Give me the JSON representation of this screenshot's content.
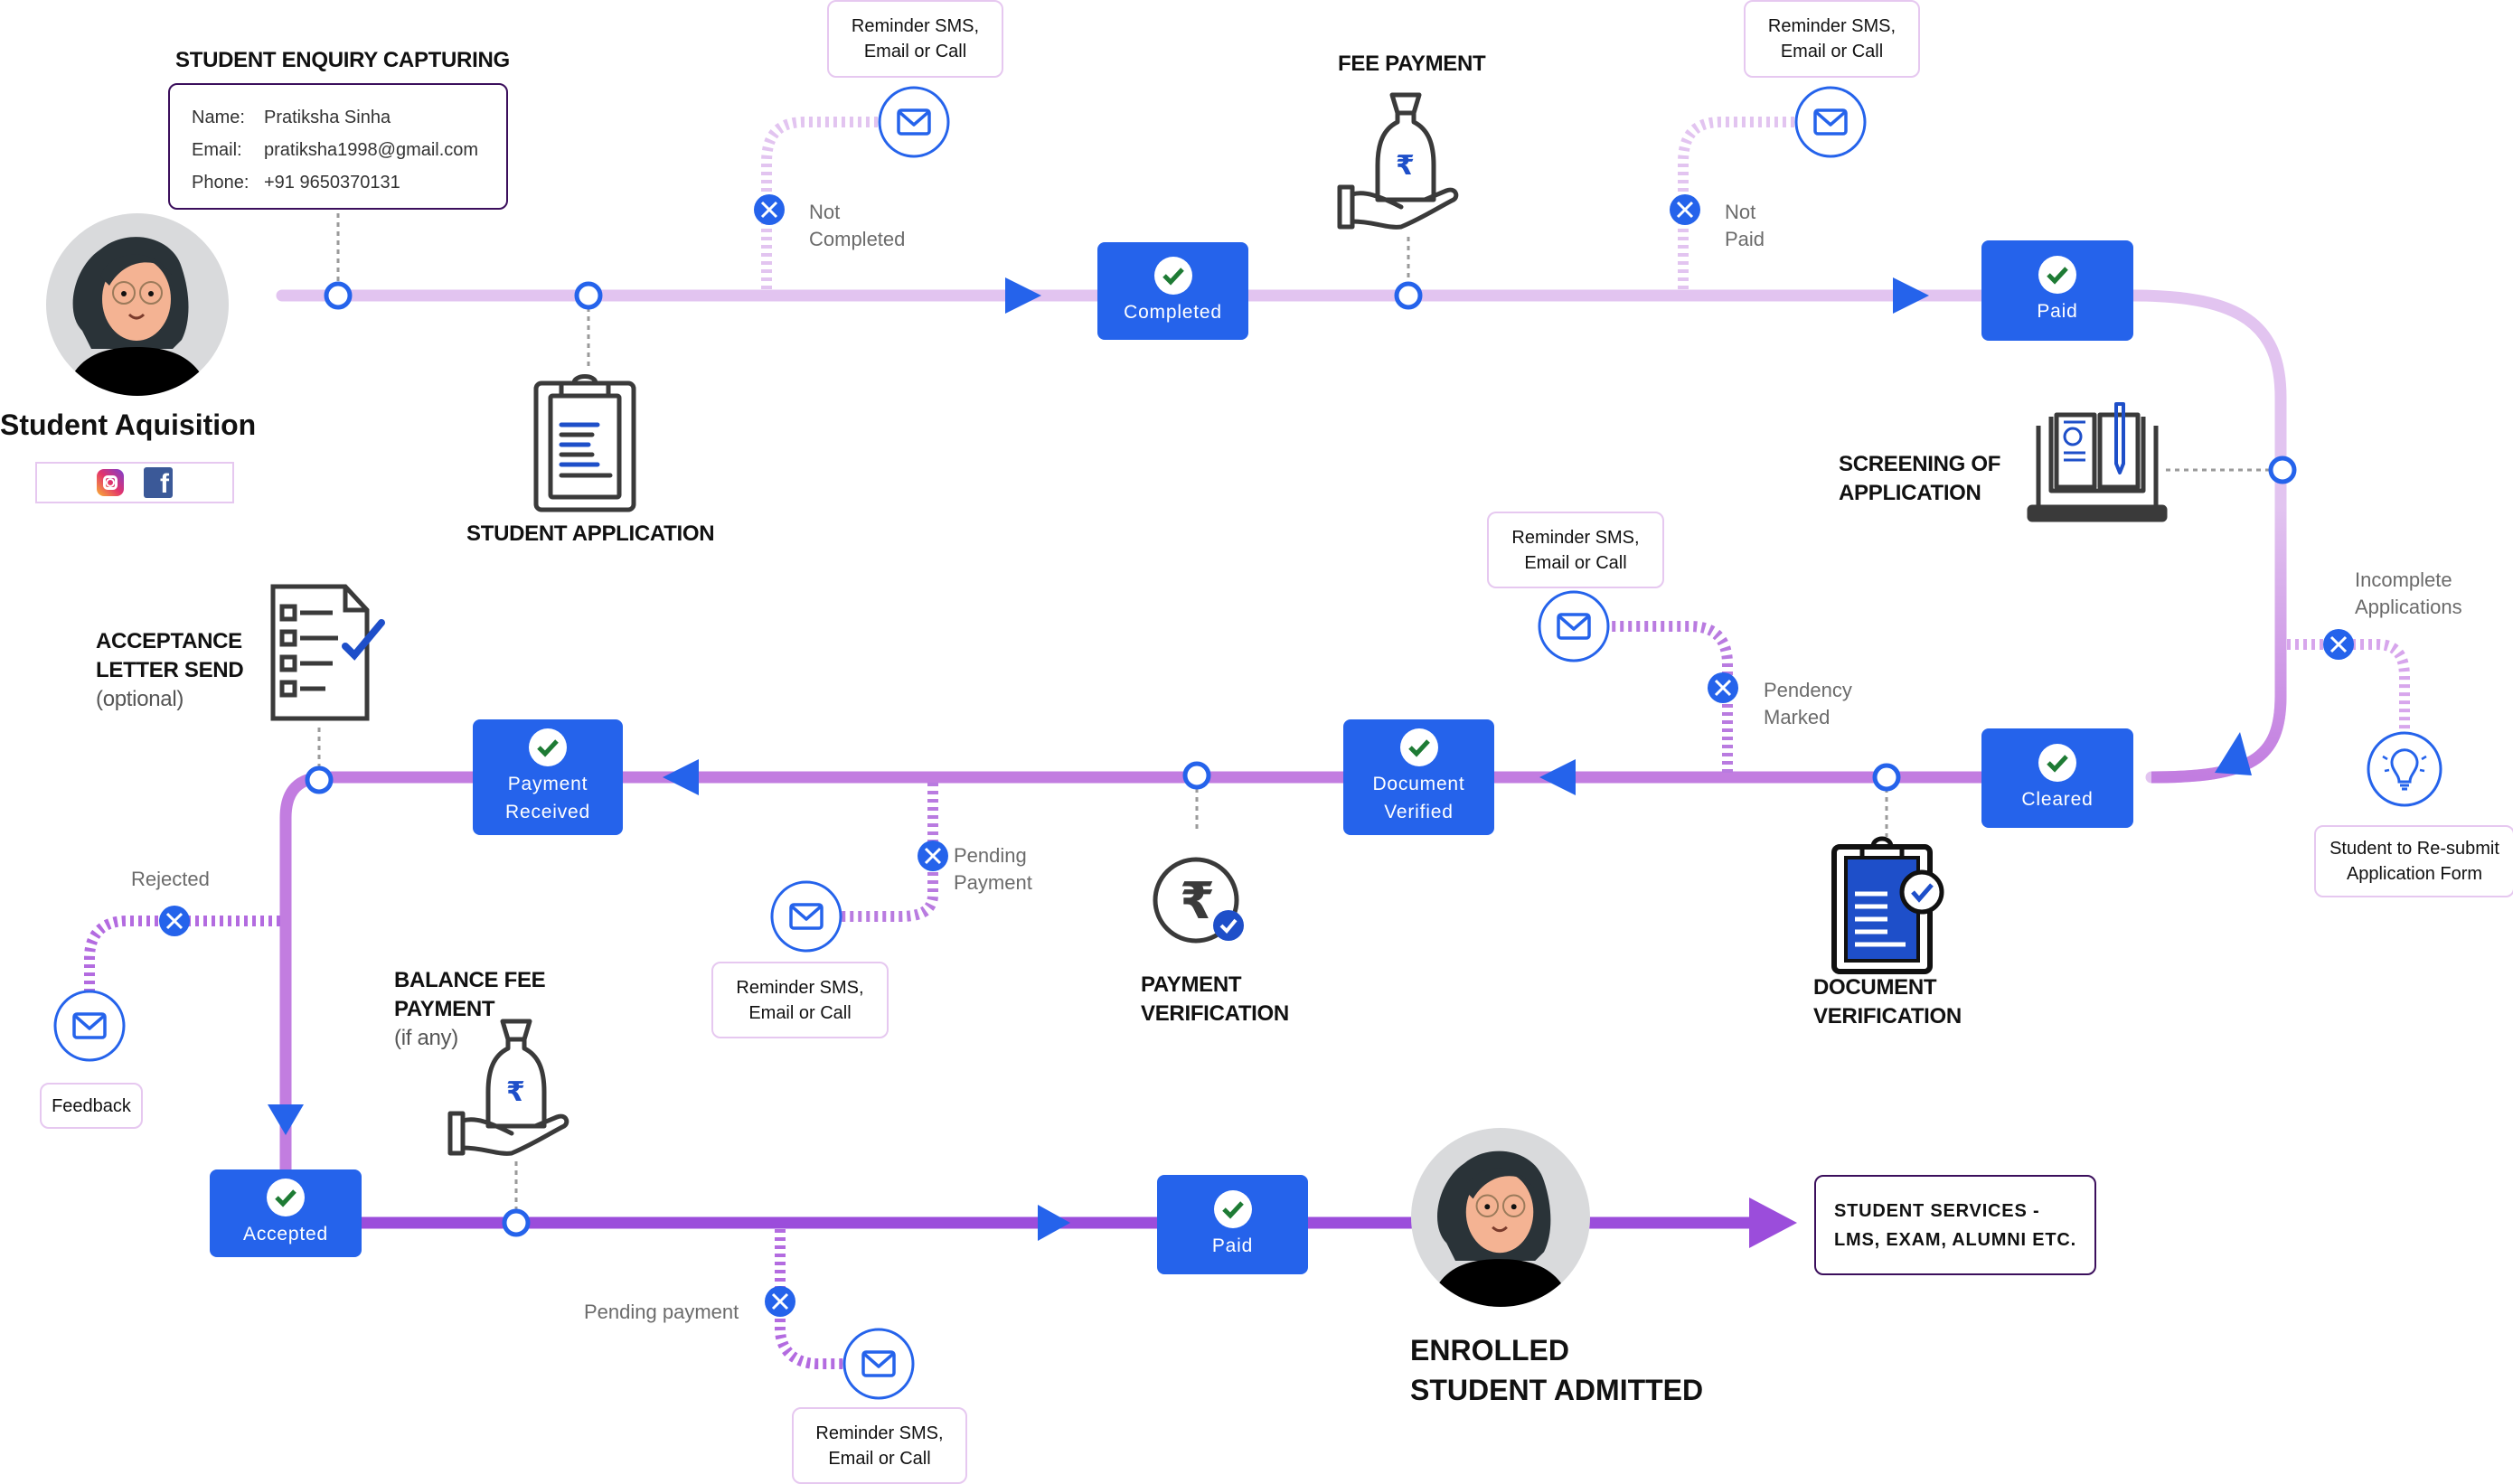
{
  "diagram": {
    "colors": {
      "primary_blue": "#2563EB",
      "track_light": "#E2C4F0",
      "track_mid": "#C27DE0",
      "track_dark": "#9B4DDB",
      "check_green": "#1E7B34",
      "note_border": "#E6C8F0",
      "box_border_dark": "#3B0F5C"
    },
    "start": {
      "title": "Student Aquisition",
      "social_icons": [
        "instagram-icon",
        "facebook-icon"
      ]
    },
    "enquiry": {
      "title": "STUDENT ENQUIRY CAPTURING",
      "fields": [
        {
          "label": "Name:",
          "value": "Pratiksha Sinha"
        },
        {
          "label": "Email:",
          "value": "pratiksha1998@gmail.com"
        },
        {
          "label": "Phone:",
          "value": "+91 9650370131"
        }
      ]
    },
    "steps": {
      "student_application": "STUDENT APPLICATION",
      "fee_payment": "FEE PAYMENT",
      "screening_line1": "SCREENING OF",
      "screening_line2": "APPLICATION",
      "document_verification_line1": "DOCUMENT",
      "document_verification_line2": "VERIFICATION",
      "payment_verification_line1": "PAYMENT",
      "payment_verification_line2": "VERIFICATION",
      "acceptance_line1": "ACCEPTANCE",
      "acceptance_line2": "LETTER SEND",
      "acceptance_note": "(optional)",
      "balance_fee_line1": "BALANCE FEE",
      "balance_fee_line2": "PAYMENT",
      "balance_fee_note": "(if any)",
      "enrolled_line1": "ENROLLED",
      "enrolled_line2": "STUDENT ADMITTED"
    },
    "status_boxes": {
      "completed": "Completed",
      "paid_top": "Paid",
      "cleared": "Cleared",
      "document_verified_1": "Document",
      "document_verified_2": "Verified",
      "payment_received_1": "Payment",
      "payment_received_2": "Received",
      "accepted": "Accepted",
      "paid_bottom": "Paid"
    },
    "branches": {
      "not_completed_1": "Not",
      "not_completed_2": "Completed",
      "not_paid_1": "Not",
      "not_paid_2": "Paid",
      "incomplete_1": "Incomplete",
      "incomplete_2": "Applications",
      "pendency_1": "Pendency",
      "pendency_2": "Marked",
      "pending_payment_1": "Pending",
      "pending_payment_2": "Payment",
      "rejected": "Rejected",
      "pending_payment_bottom": "Pending payment"
    },
    "notes": {
      "reminder_line1": "Reminder SMS,",
      "reminder_line2": "Email or Call",
      "resubmit_line1": "Student to Re-submit",
      "resubmit_line2": "Application Form",
      "feedback": "Feedback"
    },
    "services": {
      "line1": "STUDENT SERVICES -",
      "line2": "LMS, EXAM, ALUMNI ETC."
    }
  }
}
